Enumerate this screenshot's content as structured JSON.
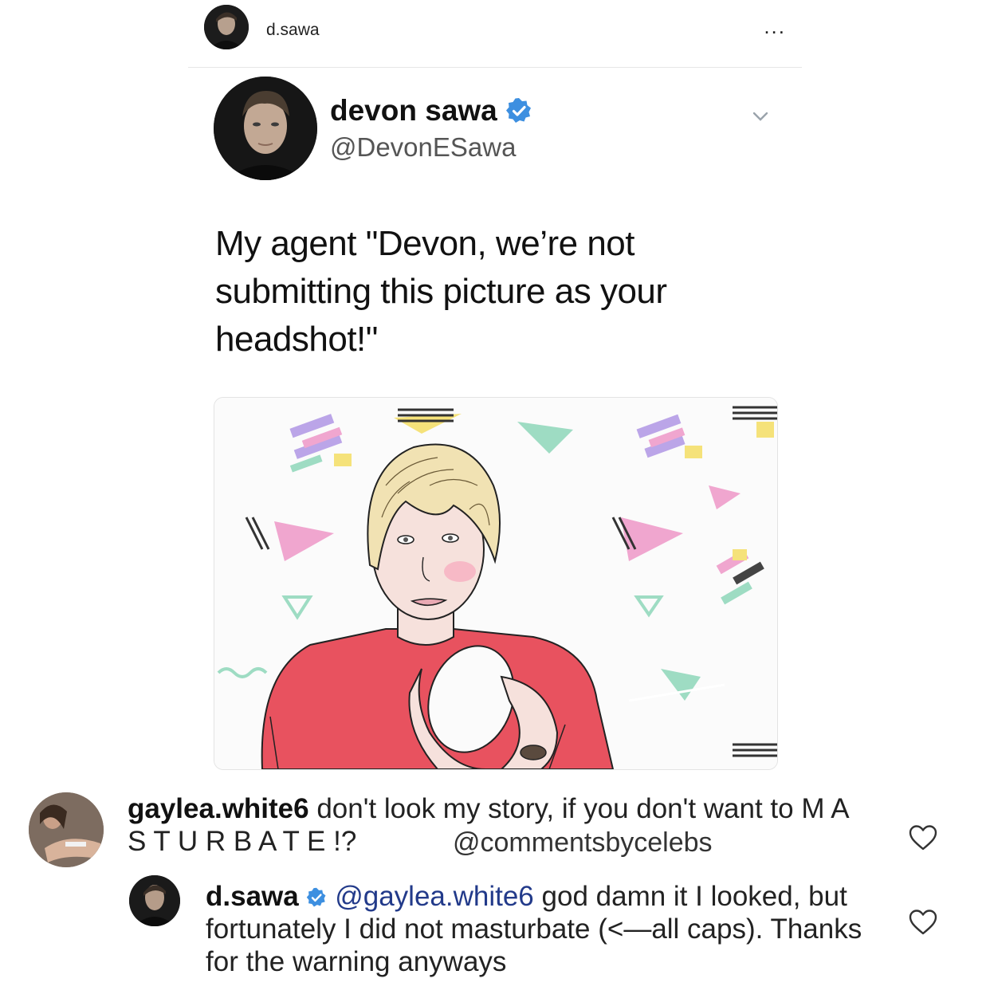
{
  "post": {
    "username": "d.sawa",
    "more_label": "...",
    "avatar": "profile-photo"
  },
  "tweet": {
    "display_name": "devon sawa",
    "handle": "@DevonESawa",
    "verified_icon": "verified-badge-icon",
    "chevron_icon": "chevron-down-icon",
    "text": "My agent \"Devon, we’re not submitting this picture as your headshot!\"",
    "image": "illustrated-portrait-memphis-pattern"
  },
  "comments": [
    {
      "username": "gaylea.white6",
      "text": "don't look my story, if you don't want to M A S T U R B A T E !?",
      "watermark": "@commentsbycelebs",
      "like_icon": "heart-outline-icon"
    },
    {
      "username": "d.sawa",
      "mention": "@gaylea.white6",
      "text": "god damn it I looked, but fortunately I did not masturbate (<—all caps). Thanks for the warning anyways",
      "verified_icon": "verified-badge-icon",
      "like_icon": "heart-outline-icon"
    }
  ],
  "colors": {
    "verified": "#3d8fe0",
    "mention": "#223a8a",
    "jersey": "#e8525f",
    "pink": "#f0a6cf",
    "mint": "#9edcc3",
    "lavender": "#bba5e8",
    "yellow": "#f5e27a"
  }
}
